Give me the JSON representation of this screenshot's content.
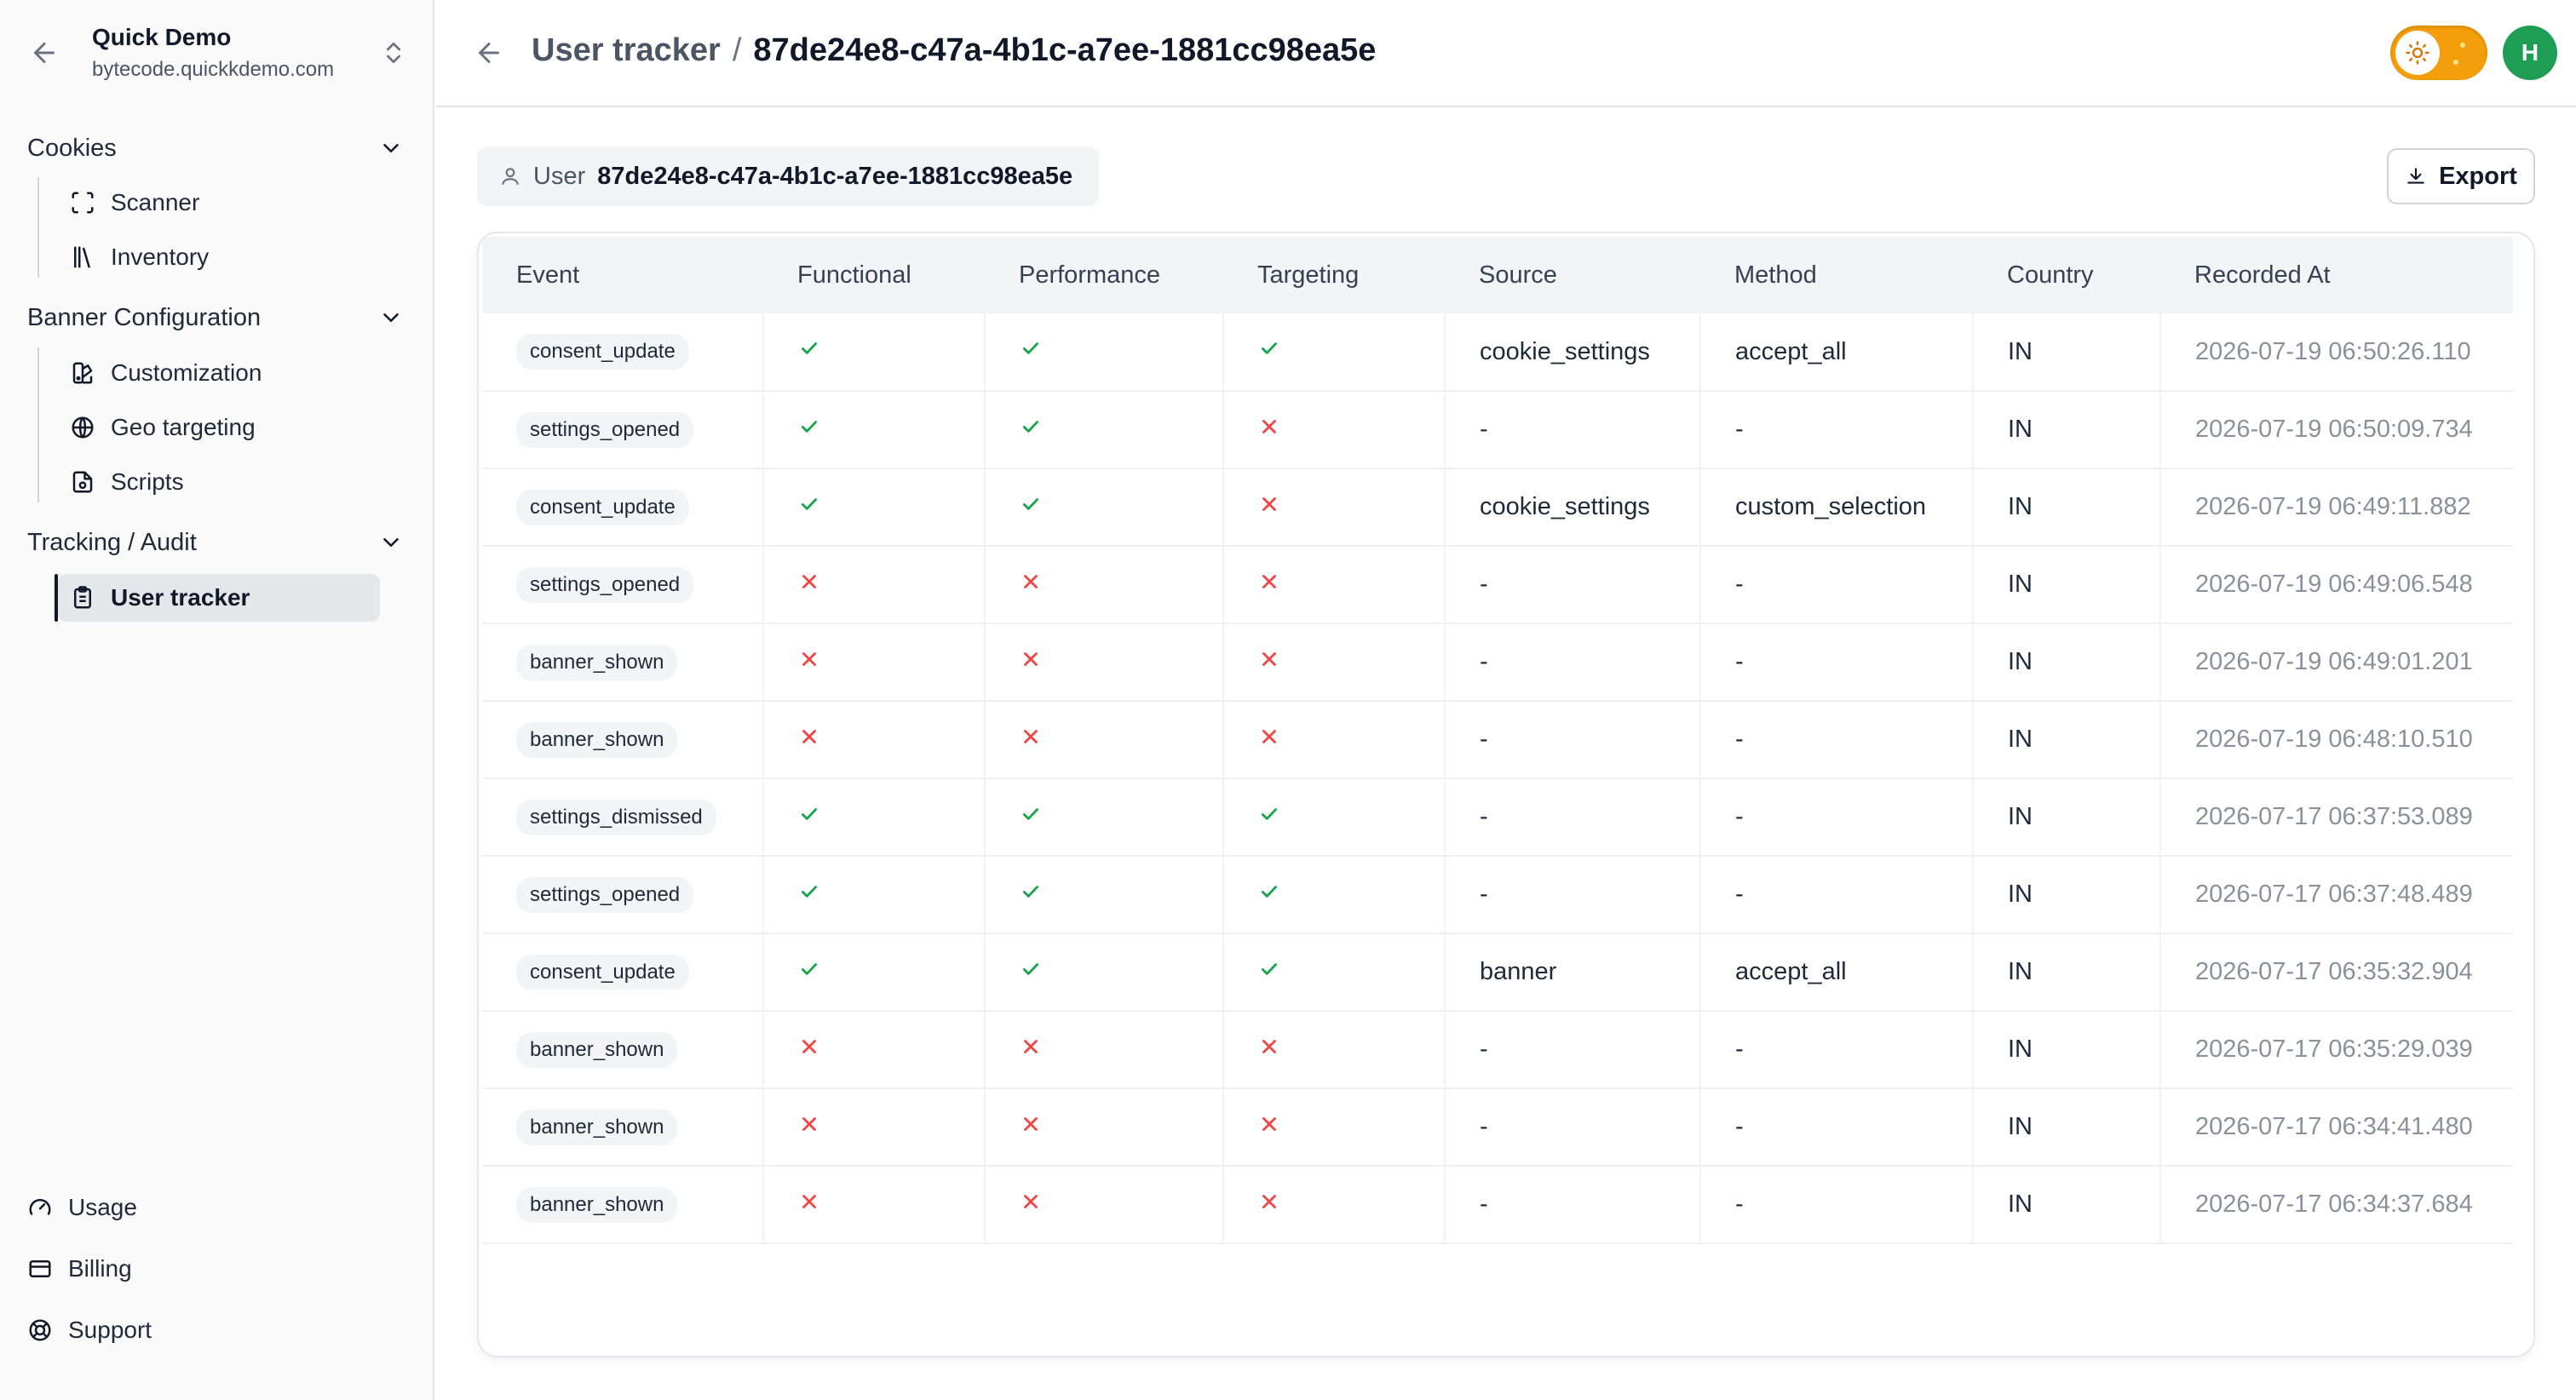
{
  "org": {
    "name": "Quick Demo",
    "domain": "bytecode.quickkdemo.com"
  },
  "nav": {
    "sections": [
      {
        "label": "Cookies",
        "items": [
          {
            "label": "Scanner",
            "icon": "scan-icon"
          },
          {
            "label": "Inventory",
            "icon": "library-icon"
          }
        ]
      },
      {
        "label": "Banner Configuration",
        "items": [
          {
            "label": "Customization",
            "icon": "palette-icon"
          },
          {
            "label": "Geo targeting",
            "icon": "globe-icon"
          },
          {
            "label": "Scripts",
            "icon": "file-code-icon"
          }
        ]
      },
      {
        "label": "Tracking / Audit",
        "items": [
          {
            "label": "User tracker",
            "icon": "clipboard-list-icon",
            "active": true
          }
        ]
      }
    ],
    "footer": [
      {
        "label": "Usage",
        "icon": "gauge-icon"
      },
      {
        "label": "Billing",
        "icon": "credit-card-icon"
      },
      {
        "label": "Support",
        "icon": "life-buoy-icon"
      }
    ]
  },
  "header": {
    "parent": "User tracker",
    "separator": "/",
    "current": "87de24e8-c47a-4b1c-a7ee-1881cc98ea5e",
    "avatar_initial": "H"
  },
  "user_chip": {
    "label": "User",
    "value": "87de24e8-c47a-4b1c-a7ee-1881cc98ea5e"
  },
  "export_label": "Export",
  "colors": {
    "check": "#16a34a",
    "cross": "#ef4444",
    "accent": "#f59e0b",
    "avatar": "#1f9d55"
  },
  "table": {
    "columns": [
      "Event",
      "Functional",
      "Performance",
      "Targeting",
      "Source",
      "Method",
      "Country",
      "Recorded At"
    ],
    "rows": [
      {
        "event": "consent_update",
        "functional": true,
        "performance": true,
        "targeting": true,
        "source": "cookie_settings",
        "method": "accept_all",
        "country": "IN",
        "recorded_at": "2026-07-19 06:50:26.110"
      },
      {
        "event": "settings_opened",
        "functional": true,
        "performance": true,
        "targeting": false,
        "source": "-",
        "method": "-",
        "country": "IN",
        "recorded_at": "2026-07-19 06:50:09.734"
      },
      {
        "event": "consent_update",
        "functional": true,
        "performance": true,
        "targeting": false,
        "source": "cookie_settings",
        "method": "custom_selection",
        "country": "IN",
        "recorded_at": "2026-07-19 06:49:11.882"
      },
      {
        "event": "settings_opened",
        "functional": false,
        "performance": false,
        "targeting": false,
        "source": "-",
        "method": "-",
        "country": "IN",
        "recorded_at": "2026-07-19 06:49:06.548"
      },
      {
        "event": "banner_shown",
        "functional": false,
        "performance": false,
        "targeting": false,
        "source": "-",
        "method": "-",
        "country": "IN",
        "recorded_at": "2026-07-19 06:49:01.201"
      },
      {
        "event": "banner_shown",
        "functional": false,
        "performance": false,
        "targeting": false,
        "source": "-",
        "method": "-",
        "country": "IN",
        "recorded_at": "2026-07-19 06:48:10.510"
      },
      {
        "event": "settings_dismissed",
        "functional": true,
        "performance": true,
        "targeting": true,
        "source": "-",
        "method": "-",
        "country": "IN",
        "recorded_at": "2026-07-17 06:37:53.089"
      },
      {
        "event": "settings_opened",
        "functional": true,
        "performance": true,
        "targeting": true,
        "source": "-",
        "method": "-",
        "country": "IN",
        "recorded_at": "2026-07-17 06:37:48.489"
      },
      {
        "event": "consent_update",
        "functional": true,
        "performance": true,
        "targeting": true,
        "source": "banner",
        "method": "accept_all",
        "country": "IN",
        "recorded_at": "2026-07-17 06:35:32.904"
      },
      {
        "event": "banner_shown",
        "functional": false,
        "performance": false,
        "targeting": false,
        "source": "-",
        "method": "-",
        "country": "IN",
        "recorded_at": "2026-07-17 06:35:29.039"
      },
      {
        "event": "banner_shown",
        "functional": false,
        "performance": false,
        "targeting": false,
        "source": "-",
        "method": "-",
        "country": "IN",
        "recorded_at": "2026-07-17 06:34:41.480"
      },
      {
        "event": "banner_shown",
        "functional": false,
        "performance": false,
        "targeting": false,
        "source": "-",
        "method": "-",
        "country": "IN",
        "recorded_at": "2026-07-17 06:34:37.684"
      }
    ]
  }
}
